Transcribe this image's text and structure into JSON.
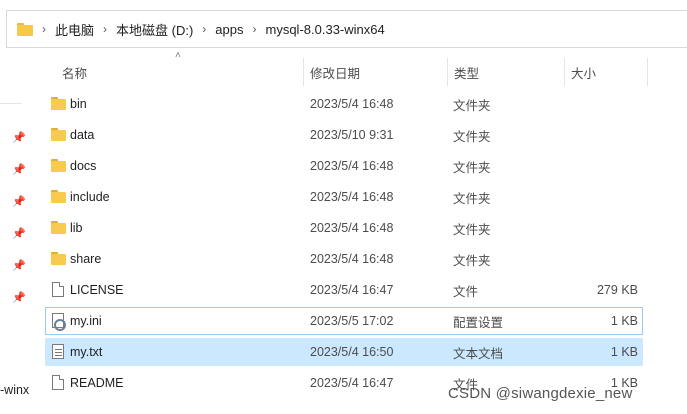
{
  "breadcrumb": {
    "items": [
      "此电脑",
      "本地磁盘 (D:)",
      "apps",
      "mysql-8.0.33-winx64"
    ],
    "separator": "›"
  },
  "columns": {
    "name": "名称",
    "date": "修改日期",
    "type": "类型",
    "size": "大小"
  },
  "nav": {
    "cut_label": "-winx"
  },
  "files": [
    {
      "name": "bin",
      "date": "2023/5/4 16:48",
      "type": "文件夹",
      "size": "",
      "icon": "folder-icon"
    },
    {
      "name": "data",
      "date": "2023/5/10 9:31",
      "type": "文件夹",
      "size": "",
      "icon": "folder-icon"
    },
    {
      "name": "docs",
      "date": "2023/5/4 16:48",
      "type": "文件夹",
      "size": "",
      "icon": "folder-icon"
    },
    {
      "name": "include",
      "date": "2023/5/4 16:48",
      "type": "文件夹",
      "size": "",
      "icon": "folder-icon"
    },
    {
      "name": "lib",
      "date": "2023/5/4 16:48",
      "type": "文件夹",
      "size": "",
      "icon": "folder-icon"
    },
    {
      "name": "share",
      "date": "2023/5/4 16:48",
      "type": "文件夹",
      "size": "",
      "icon": "folder-icon"
    },
    {
      "name": "LICENSE",
      "date": "2023/5/4 16:47",
      "type": "文件",
      "size": "279 KB",
      "icon": "file-icon"
    },
    {
      "name": "my.ini",
      "date": "2023/5/5 17:02",
      "type": "配置设置",
      "size": "1 KB",
      "icon": "settings-file-icon"
    },
    {
      "name": "my.txt",
      "date": "2023/5/4 16:50",
      "type": "文本文档",
      "size": "1 KB",
      "icon": "text-file-icon"
    },
    {
      "name": "README",
      "date": "2023/5/4 16:47",
      "type": "文件",
      "size": "1 KB",
      "icon": "file-icon"
    }
  ],
  "watermark": "CSDN @siwangdexie_new"
}
